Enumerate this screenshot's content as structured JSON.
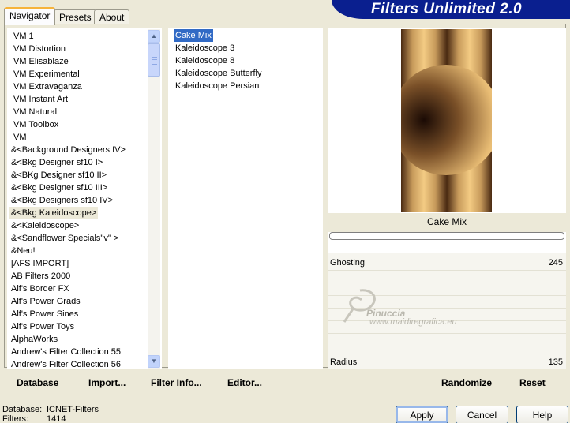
{
  "app": {
    "title": "Filters Unlimited 2.0"
  },
  "tabs": [
    {
      "label": "Navigator",
      "active": true
    },
    {
      "label": "Presets",
      "active": false
    },
    {
      "label": "About",
      "active": false
    }
  ],
  "categories": {
    "selected_index": 14,
    "items": [
      "VM 1",
      "VM Distortion",
      "VM Elisablaze",
      "VM Experimental",
      "VM Extravaganza",
      "VM Instant Art",
      "VM Natural",
      "VM Toolbox",
      "VM",
      "&<Background Designers IV>",
      "&<Bkg Designer sf10 I>",
      "&<BKg Designer sf10 II>",
      "&<Bkg Designer sf10 III>",
      "&<Bkg Designers sf10 IV>",
      "&<Bkg Kaleidoscope>",
      "&<Kaleidoscope>",
      "&<Sandflower Specials\"v\" >",
      "&Neu!",
      "[AFS IMPORT]",
      "AB Filters 2000",
      "Alf's Border FX",
      "Alf's Power Grads",
      "Alf's Power Sines",
      "Alf's Power Toys",
      "AlphaWorks",
      "Andrew's Filter Collection 55",
      "Andrew's Filter Collection 56"
    ]
  },
  "filters": {
    "selected_index": 0,
    "items": [
      "Cake Mix",
      "Kaleidoscope 3",
      "Kaleidoscope 8",
      "Kaleidoscope Butterfly",
      "Kaleidoscope Persian"
    ]
  },
  "preview": {
    "filter_name": "Cake Mix",
    "progress": 0
  },
  "params": [
    {
      "label": "Ghosting",
      "value": "245"
    },
    {
      "label": "Radius",
      "value": "135"
    }
  ],
  "watermark": {
    "line1": "Pinuccia",
    "line2": "www.maidiregrafica.eu"
  },
  "actions": {
    "database": "Database",
    "import": "Import...",
    "filter_info": "Filter Info...",
    "editor": "Editor...",
    "randomize": "Randomize",
    "reset": "Reset"
  },
  "footer": {
    "database_label": "Database:",
    "database_value": "ICNET-Filters",
    "filters_label": "Filters:",
    "filters_value": "1414"
  },
  "buttons": {
    "apply": "Apply",
    "cancel": "Cancel",
    "help": "Help"
  },
  "colors": {
    "accent": "#0a1f8f",
    "selection": "#316ac5",
    "tab_highlight": "#f6b33b"
  }
}
